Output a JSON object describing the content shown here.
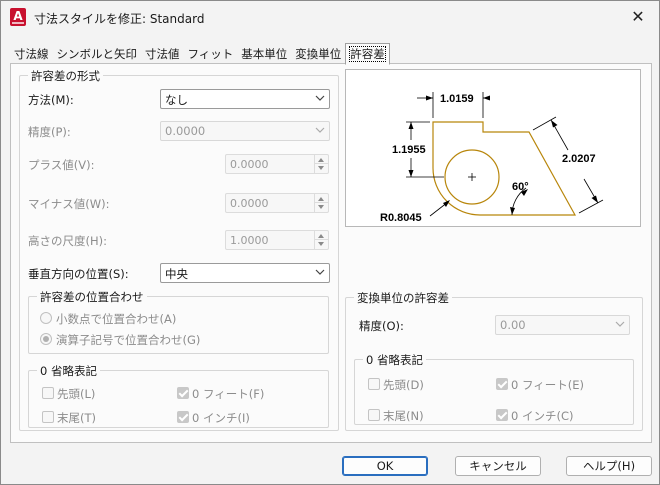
{
  "window": {
    "title": "寸法スタイルを修正: Standard",
    "app_icon": "A",
    "close_glyph": "✕"
  },
  "tabs": [
    {
      "label": "寸法線",
      "active": false
    },
    {
      "label": "シンボルと矢印",
      "active": false
    },
    {
      "label": "寸法値",
      "active": false
    },
    {
      "label": "フィット",
      "active": false
    },
    {
      "label": "基本単位",
      "active": false
    },
    {
      "label": "変換単位",
      "active": false
    },
    {
      "label": "許容差",
      "active": true
    }
  ],
  "tolerance_format": {
    "title": "許容差の形式",
    "method_label": "方法(M):",
    "method_value": "なし",
    "precision_label": "精度(P):",
    "precision_value": "0.0000",
    "upper_label": "プラス値(V):",
    "upper_value": "0.0000",
    "lower_label": "マイナス値(W):",
    "lower_value": "0.0000",
    "height_label": "高さの尺度(H):",
    "height_value": "1.0000",
    "vertical_label": "垂直方向の位置(S):",
    "vertical_value": "中央"
  },
  "alignment": {
    "title": "許容差の位置合わせ",
    "option1": "小数点で位置合わせ(A)",
    "option2": "演算子記号で位置合わせ(G)"
  },
  "zero_left": {
    "title": "0 省略表記",
    "leading": "先頭(L)",
    "trailing": "末尾(T)",
    "feet": "0 フィート(F)",
    "inches": "0 インチ(I)"
  },
  "alt_units": {
    "title": "変換単位の許容差",
    "precision_label": "精度(O):",
    "precision_value": "0.00"
  },
  "zero_right": {
    "title": "0 省略表記",
    "leading": "先頭(D)",
    "trailing": "末尾(N)",
    "feet": "0 フィート(E)",
    "inches": "0 インチ(C)"
  },
  "preview": {
    "dim_top": "1.0159",
    "dim_left": "1.1955",
    "dim_right": "2.0207",
    "dim_angle": "60°",
    "dim_radius": "R0.8045"
  },
  "buttons": {
    "ok": "OK",
    "cancel": "キャンセル",
    "help": "ヘルプ(H)"
  },
  "colors": {
    "part_outline": "#b8860b",
    "default_button_border": "#2a6ebf"
  }
}
